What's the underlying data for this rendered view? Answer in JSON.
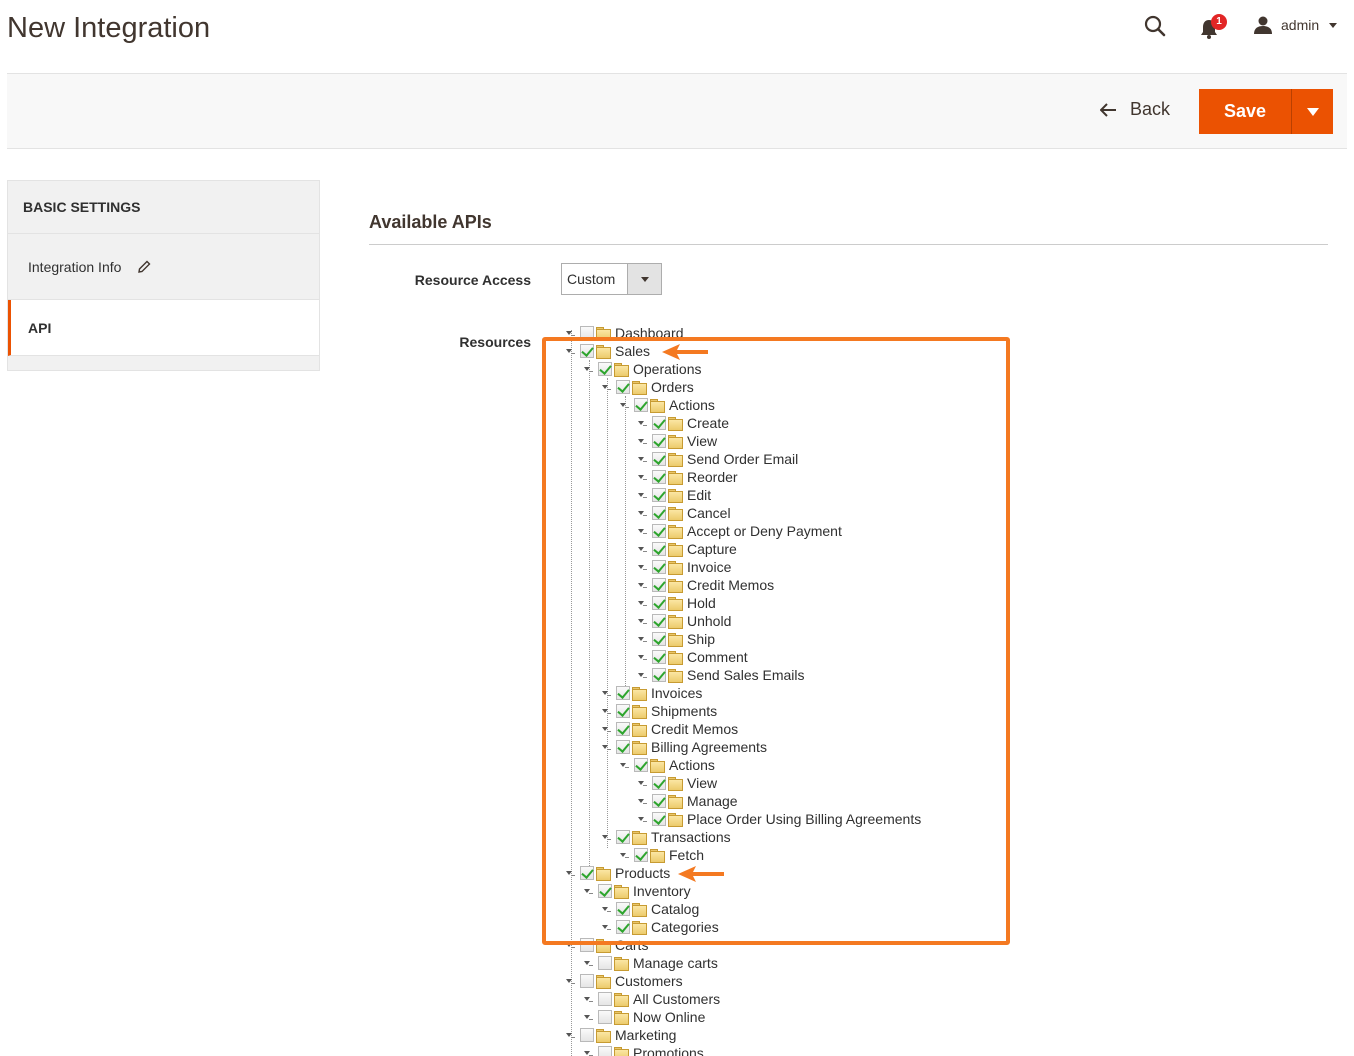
{
  "page": {
    "title": "New Integration"
  },
  "header": {
    "notification_count": "1",
    "user_name": "admin"
  },
  "actions": {
    "back_label": "Back",
    "save_label": "Save"
  },
  "sidebar": {
    "heading": "BASIC SETTINGS",
    "items": [
      {
        "label": "Integration Info"
      },
      {
        "label": "API"
      }
    ]
  },
  "main": {
    "section_title": "Available APIs",
    "resource_access_label": "Resource Access",
    "resource_access_value": "Custom",
    "resources_label": "Resources"
  },
  "tree": [
    {
      "label": "Dashboard",
      "depth": 0,
      "checked": false
    },
    {
      "label": "Sales",
      "depth": 0,
      "checked": true
    },
    {
      "label": "Operations",
      "depth": 1,
      "checked": true
    },
    {
      "label": "Orders",
      "depth": 2,
      "checked": true
    },
    {
      "label": "Actions",
      "depth": 3,
      "checked": true
    },
    {
      "label": "Create",
      "depth": 4,
      "checked": true
    },
    {
      "label": "View",
      "depth": 4,
      "checked": true
    },
    {
      "label": "Send Order Email",
      "depth": 4,
      "checked": true
    },
    {
      "label": "Reorder",
      "depth": 4,
      "checked": true
    },
    {
      "label": "Edit",
      "depth": 4,
      "checked": true
    },
    {
      "label": "Cancel",
      "depth": 4,
      "checked": true
    },
    {
      "label": "Accept or Deny Payment",
      "depth": 4,
      "checked": true
    },
    {
      "label": "Capture",
      "depth": 4,
      "checked": true
    },
    {
      "label": "Invoice",
      "depth": 4,
      "checked": true
    },
    {
      "label": "Credit Memos",
      "depth": 4,
      "checked": true
    },
    {
      "label": "Hold",
      "depth": 4,
      "checked": true
    },
    {
      "label": "Unhold",
      "depth": 4,
      "checked": true
    },
    {
      "label": "Ship",
      "depth": 4,
      "checked": true
    },
    {
      "label": "Comment",
      "depth": 4,
      "checked": true
    },
    {
      "label": "Send Sales Emails",
      "depth": 4,
      "checked": true
    },
    {
      "label": "Invoices",
      "depth": 2,
      "checked": true
    },
    {
      "label": "Shipments",
      "depth": 2,
      "checked": true
    },
    {
      "label": "Credit Memos",
      "depth": 2,
      "checked": true
    },
    {
      "label": "Billing Agreements",
      "depth": 2,
      "checked": true
    },
    {
      "label": "Actions",
      "depth": 3,
      "checked": true
    },
    {
      "label": "View",
      "depth": 4,
      "checked": true
    },
    {
      "label": "Manage",
      "depth": 4,
      "checked": true
    },
    {
      "label": "Place Order Using Billing Agreements",
      "depth": 4,
      "checked": true
    },
    {
      "label": "Transactions",
      "depth": 2,
      "checked": true
    },
    {
      "label": "Fetch",
      "depth": 3,
      "checked": true
    },
    {
      "label": "Products",
      "depth": 0,
      "checked": true
    },
    {
      "label": "Inventory",
      "depth": 1,
      "checked": true
    },
    {
      "label": "Catalog",
      "depth": 2,
      "checked": true
    },
    {
      "label": "Categories",
      "depth": 2,
      "checked": true
    },
    {
      "label": "Carts",
      "depth": 0,
      "checked": false
    },
    {
      "label": "Manage carts",
      "depth": 1,
      "checked": false
    },
    {
      "label": "Customers",
      "depth": 0,
      "checked": false
    },
    {
      "label": "All Customers",
      "depth": 1,
      "checked": false
    },
    {
      "label": "Now Online",
      "depth": 1,
      "checked": false
    },
    {
      "label": "Marketing",
      "depth": 0,
      "checked": false
    },
    {
      "label": "Promotions",
      "depth": 1,
      "checked": false
    }
  ],
  "colors": {
    "accent": "#eb5202",
    "annotation": "#f47921",
    "check": "#2ea52e"
  }
}
